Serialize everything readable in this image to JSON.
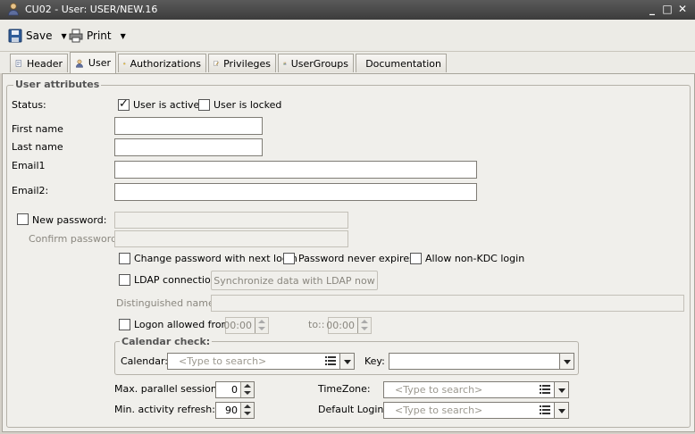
{
  "window": {
    "title": "CU02 - User: USER/NEW.16",
    "min": "_",
    "max": "□",
    "close": "✕"
  },
  "toolbar": {
    "save": "Save",
    "print": "Print"
  },
  "tabs": [
    {
      "label": "Header"
    },
    {
      "label": "User"
    },
    {
      "label": "Authorizations"
    },
    {
      "label": "Privileges"
    },
    {
      "label": "UserGroups"
    },
    {
      "label": "Documentation"
    }
  ],
  "user_attributes": {
    "legend": "User attributes",
    "status_label": "Status:",
    "active_label": "User is active",
    "locked_label": "User is locked",
    "first_name_label": "First name",
    "last_name_label": "Last name",
    "email1_label": "Email1",
    "email2_label": "Email2:",
    "new_password_label": "New password:",
    "confirm_password_label": "Confirm password:",
    "change_pw_label": "Change password with next login",
    "pw_never_expires_label": "Password never expires",
    "non_kdc_label": "Allow non-KDC login",
    "ldap_label": "LDAP connection",
    "sync_ldap_button": "Synchronize data with LDAP now",
    "dn_label": "Distinguished name:",
    "logon_from_label": "Logon allowed from:",
    "logon_from_value": "00:00",
    "to_label": "to::",
    "to_value": "00:00",
    "calendar_legend": "Calendar check:",
    "calendar_label": "Calendar:",
    "calendar_placeholder": "<Type to search>",
    "key_label": "Key:",
    "max_sessions_label": "Max. parallel sessions:",
    "max_sessions_value": "0",
    "min_refresh_label": "Min. activity refresh:",
    "min_refresh_value": "90",
    "timezone_label": "TimeZone:",
    "timezone_placeholder": "<Type to search>",
    "default_login_label": "Default Login:",
    "default_login_placeholder": "<Type to search>"
  },
  "state": {
    "user_is_active": true,
    "user_is_locked": false
  }
}
